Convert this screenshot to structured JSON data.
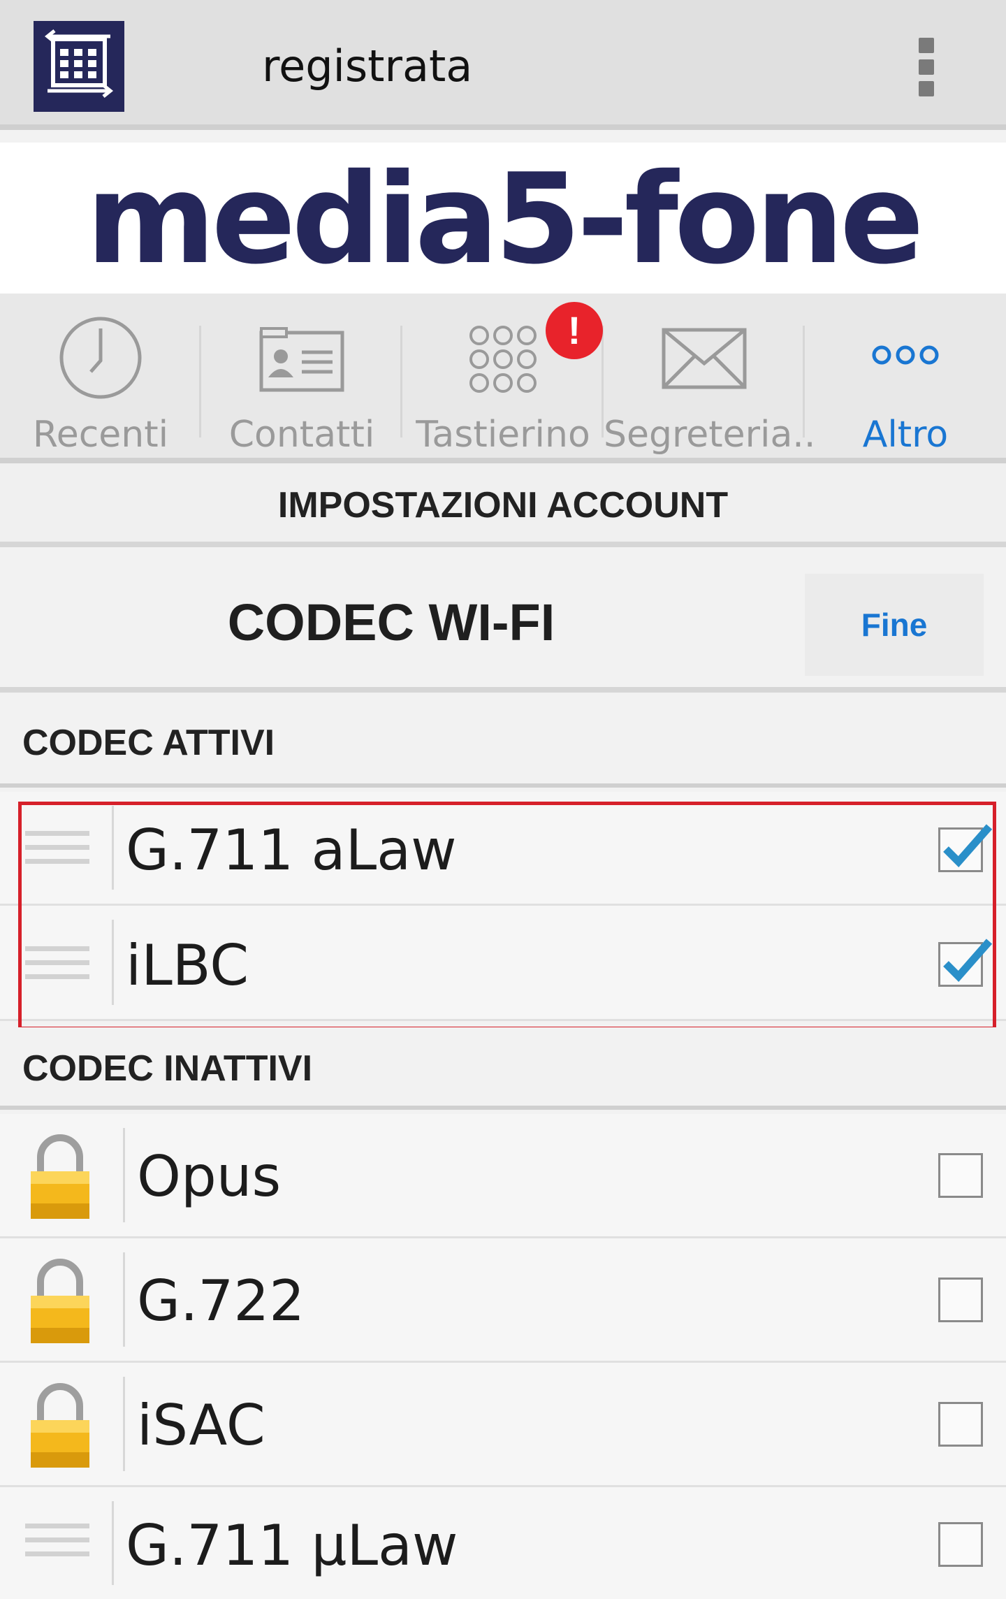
{
  "appbar": {
    "title": "registrata",
    "app_icon": "keypad-grid-icon",
    "menu_icon": "overflow-menu-icon"
  },
  "logo": {
    "text": "media5-fone",
    "color": "#25275a"
  },
  "tabs": [
    {
      "label": "Recenti",
      "icon": "clock-icon",
      "active": false
    },
    {
      "label": "Contatti",
      "icon": "contact-card-icon",
      "active": false
    },
    {
      "label": "Tastierino",
      "icon": "keypad-icon",
      "active": false,
      "badge": "!"
    },
    {
      "label": "Segreteria..",
      "icon": "envelope-icon",
      "active": false
    },
    {
      "label": "Altro",
      "icon": "more-icon",
      "active": true
    }
  ],
  "account_settings": {
    "title": "IMPOSTAZIONI ACCOUNT"
  },
  "codec_page": {
    "title": "CODEC WI-FI",
    "done_label": "Fine"
  },
  "active_section": {
    "header": "CODEC ATTIVI",
    "items": [
      {
        "name": "G.711 aLaw",
        "checked": true
      },
      {
        "name": "iLBC",
        "checked": true
      }
    ]
  },
  "inactive_section": {
    "header": "CODEC INATTIVI",
    "items": [
      {
        "name": "Opus",
        "checked": false,
        "locked": true
      },
      {
        "name": "G.722",
        "checked": false,
        "locked": true
      },
      {
        "name": "iSAC",
        "checked": false,
        "locked": true
      },
      {
        "name": "G.711 µLaw",
        "checked": false,
        "locked": false
      }
    ]
  },
  "colors": {
    "accent": "#1976d2",
    "badge": "#e8232b",
    "highlight_border": "#d6202a",
    "check": "#2a8fc9"
  }
}
